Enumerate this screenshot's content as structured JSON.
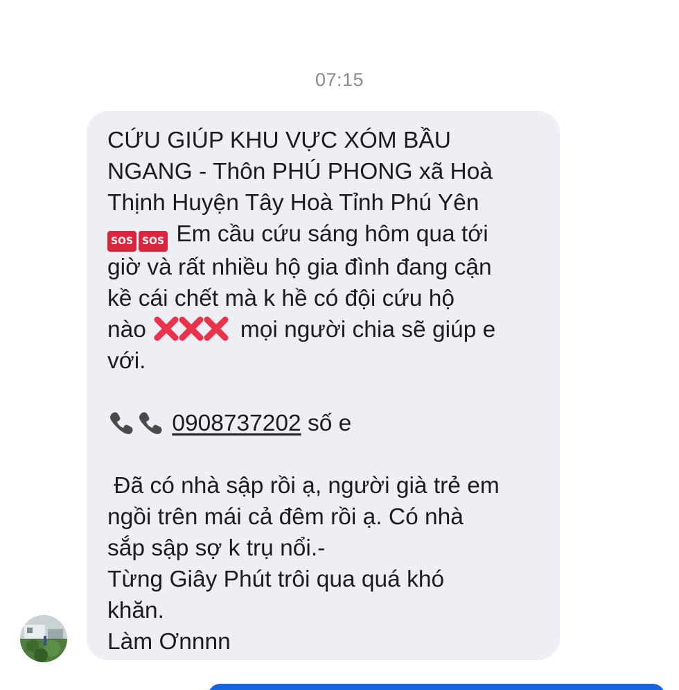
{
  "conversation": {
    "timestamp": "07:15"
  },
  "message": {
    "para1": {
      "l1": "CỨU GIÚP KHU VỰC XÓM BẦU",
      "l2": "NGANG - Thôn PHÚ PHONG  xã Hoà",
      "l3": "Thịnh Huyện Tây Hoà Tỉnh Phú Yên",
      "l4": "Em cầu cứu sáng hôm qua tới",
      "l5": "giờ  và rất nhiều hộ gia đình đang cận",
      "l6": "kề cái chết mà k hề có đội cứu hộ",
      "l7a": "nào",
      "l7b": "mọi người chia sẽ giúp e",
      "l8": "với."
    },
    "sos_label": "SOS",
    "phone": {
      "number": "0908737202",
      "suffix": "số e"
    },
    "para3": {
      "l1": " Đã có nhà sập rồi ạ, người già trẻ em",
      "l2": "ngồi trên mái cả đêm rồi ạ. Có nhà",
      "l3": "sắp sập sợ k trụ nổi.-",
      "l4": "Từng Giây Phút trôi qua quá khó",
      "l5": "khăn.",
      "l6": "Làm Ơnnnn"
    }
  },
  "icons": {
    "sos": "sos-emoji-icon",
    "cross": "cross-mark-emoji-icon",
    "phone": "telephone-receiver-emoji-icon"
  },
  "colors": {
    "bubble": "#eeeff4",
    "text": "#1c1c1e",
    "timestamp": "#8a8a8e",
    "sos": "#d7263d",
    "cross": "#e8334a",
    "accent": "#1565e0"
  }
}
